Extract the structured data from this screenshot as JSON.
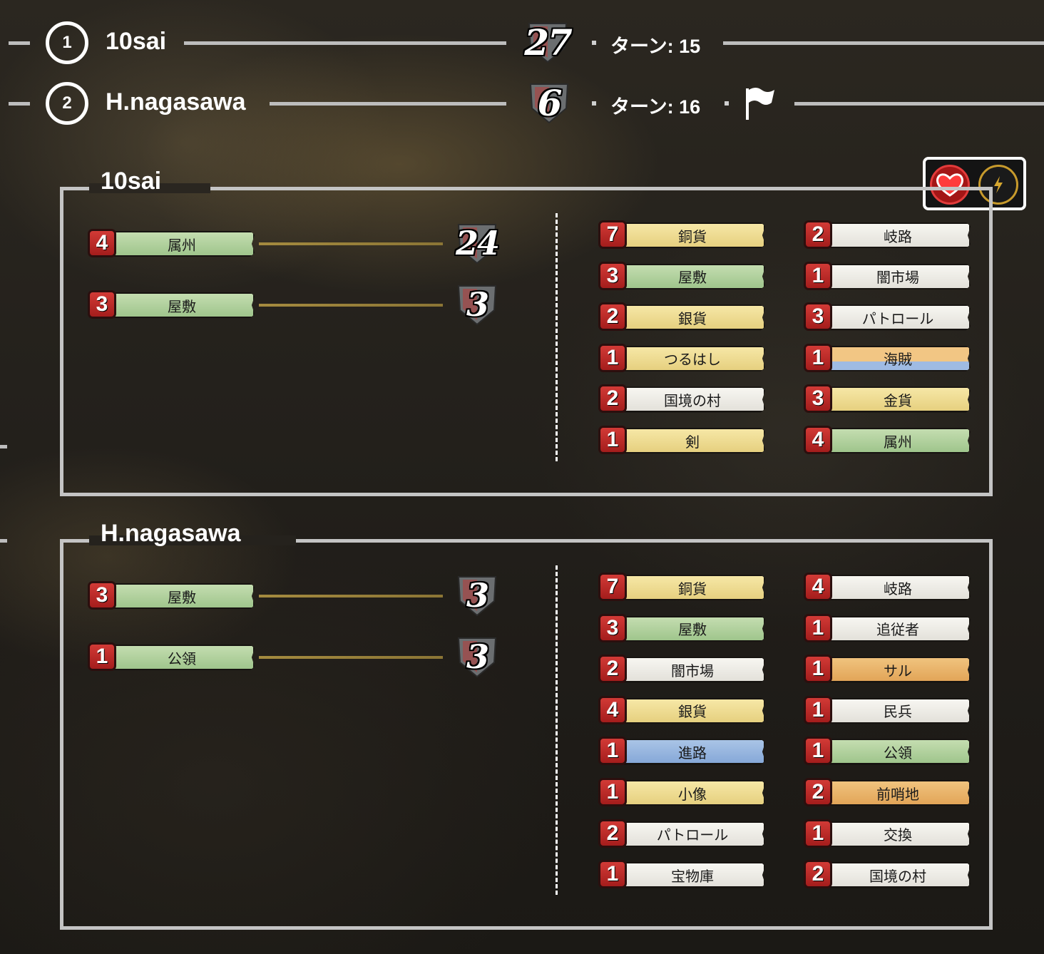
{
  "scoreboard": [
    {
      "rank": "1",
      "name": "10sai",
      "score": "27",
      "turn": "ターン: 15",
      "surrendered": false
    },
    {
      "rank": "2",
      "name": "H.nagasawa",
      "score": "6",
      "turn": "ターン: 16",
      "surrendered": true
    }
  ],
  "icons": {
    "flag": "flag-icon",
    "heart": "heart-icon",
    "lightning": "lightning-icon"
  },
  "colors": {
    "badge_red": "#c0302c",
    "card_white": "#efede7",
    "card_yellow": "#efdc92",
    "card_green": "#b3d19e",
    "card_orange": "#eab46b",
    "card_blue": "#98b6df",
    "gold_line": "#a58b3f"
  },
  "panels": [
    {
      "title": "10sai",
      "vp_cards": [
        {
          "count": "4",
          "name": "属州",
          "color": "green",
          "points": "24"
        },
        {
          "count": "3",
          "name": "屋敷",
          "color": "green",
          "points": "3"
        }
      ],
      "deck_left": [
        {
          "count": "7",
          "name": "銅貨",
          "color": "yellow"
        },
        {
          "count": "3",
          "name": "屋敷",
          "color": "green"
        },
        {
          "count": "2",
          "name": "銀貨",
          "color": "yellow"
        },
        {
          "count": "1",
          "name": "つるはし",
          "color": "yellow"
        },
        {
          "count": "2",
          "name": "国境の村",
          "color": "white"
        },
        {
          "count": "1",
          "name": "剣",
          "color": "yellow"
        }
      ],
      "deck_right": [
        {
          "count": "2",
          "name": "岐路",
          "color": "white"
        },
        {
          "count": "1",
          "name": "闇市場",
          "color": "white"
        },
        {
          "count": "3",
          "name": "パトロール",
          "color": "white"
        },
        {
          "count": "1",
          "name": "海賊",
          "color": "pirate"
        },
        {
          "count": "3",
          "name": "金貨",
          "color": "yellow"
        },
        {
          "count": "4",
          "name": "属州",
          "color": "green"
        }
      ]
    },
    {
      "title": "H.nagasawa",
      "vp_cards": [
        {
          "count": "3",
          "name": "屋敷",
          "color": "green",
          "points": "3"
        },
        {
          "count": "1",
          "name": "公領",
          "color": "green",
          "points": "3"
        }
      ],
      "deck_left": [
        {
          "count": "7",
          "name": "銅貨",
          "color": "yellow"
        },
        {
          "count": "3",
          "name": "屋敷",
          "color": "green"
        },
        {
          "count": "2",
          "name": "闇市場",
          "color": "white"
        },
        {
          "count": "4",
          "name": "銀貨",
          "color": "yellow"
        },
        {
          "count": "1",
          "name": "進路",
          "color": "blue"
        },
        {
          "count": "1",
          "name": "小像",
          "color": "yellow"
        },
        {
          "count": "2",
          "name": "パトロール",
          "color": "white"
        },
        {
          "count": "1",
          "name": "宝物庫",
          "color": "white"
        }
      ],
      "deck_right": [
        {
          "count": "4",
          "name": "岐路",
          "color": "white"
        },
        {
          "count": "1",
          "name": "追従者",
          "color": "white"
        },
        {
          "count": "1",
          "name": "サル",
          "color": "orange"
        },
        {
          "count": "1",
          "name": "民兵",
          "color": "white"
        },
        {
          "count": "1",
          "name": "公領",
          "color": "green"
        },
        {
          "count": "2",
          "name": "前哨地",
          "color": "orange"
        },
        {
          "count": "1",
          "name": "交換",
          "color": "white"
        },
        {
          "count": "2",
          "name": "国境の村",
          "color": "white"
        }
      ]
    }
  ]
}
